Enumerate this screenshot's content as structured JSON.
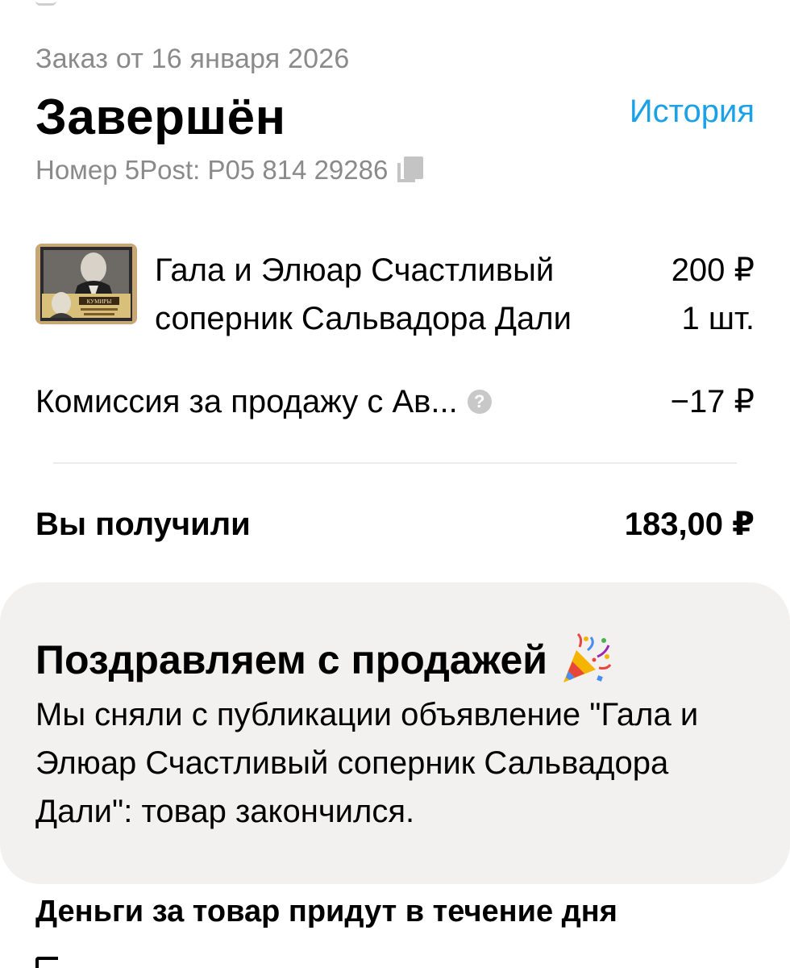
{
  "order": {
    "date_label": "Заказ от 16 января 2026",
    "status": "Завершён",
    "history_link": "История",
    "tracking_label": "Номер 5Post: P05 814 29286",
    "copy_icon": "copy-icon"
  },
  "item": {
    "title": "Гала и Элюар Счастливый соперник Сальвадора Дали",
    "price": "200 ₽",
    "quantity": "1 шт.",
    "thumbnail_text": "КУМИРЫ"
  },
  "fee": {
    "label": "Комиссия за продажу с Ав...",
    "amount": "−17 ₽",
    "help_icon": "?"
  },
  "total": {
    "label": "Вы получили",
    "amount": "183,00 ₽"
  },
  "congrats": {
    "title": "Поздравляем с продажей",
    "icon": "party-popper-icon",
    "text": "Мы сняли с публикации объявление \"Гала и Элюар Счастливый соперник Сальвадора Дали\": товар закончился."
  },
  "money_notice": {
    "heading": "Деньги за товар придут в течение дня"
  },
  "colors": {
    "accent": "#1ba1e6",
    "muted_text": "#8a8a8a",
    "card_background": "#f2f1f0",
    "divider": "#ececec"
  }
}
